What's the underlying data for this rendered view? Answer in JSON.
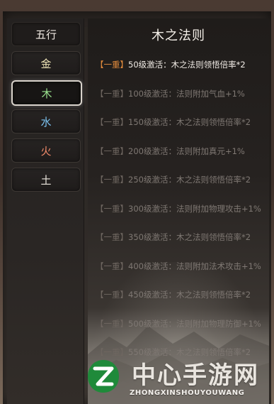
{
  "elements": {
    "header_label": "五行",
    "items": [
      {
        "label": "金",
        "color": "#f0e6b8"
      },
      {
        "label": "木",
        "color": "#9be38f"
      },
      {
        "label": "水",
        "color": "#7cc4f2"
      },
      {
        "label": "火",
        "color": "#f08a6a"
      },
      {
        "label": "土",
        "color": "#e9e4dc"
      }
    ]
  },
  "law_panel": {
    "title": "木之法则",
    "rows": [
      {
        "tier": "【一重】",
        "text": "50级激活：木之法则领悟倍率*2",
        "active": true
      },
      {
        "tier": "【一重】",
        "text": "100级激活：法则附加气血+1%",
        "active": false
      },
      {
        "tier": "【一重】",
        "text": "150级激活：木之法则领悟倍率*2",
        "active": false
      },
      {
        "tier": "【一重】",
        "text": "200级激活：法则附加真元+1%",
        "active": false
      },
      {
        "tier": "【一重】",
        "text": "250级激活：木之法则领悟倍率*2",
        "active": false
      },
      {
        "tier": "【一重】",
        "text": "300级激活：法则附加物理攻击+1%",
        "active": false
      },
      {
        "tier": "【一重】",
        "text": "350级激活：木之法则领悟倍率*2",
        "active": false
      },
      {
        "tier": "【一重】",
        "text": "400级激活：法则附加法术攻击+1%",
        "active": false
      },
      {
        "tier": "【一重】",
        "text": "450级激活：木之法则领悟倍率*2",
        "active": false
      },
      {
        "tier": "【一重】",
        "text": "500级激活：法则附加物理防御+1%",
        "active": false
      },
      {
        "tier": "【一重】",
        "text": "550级激活：木之法则领悟倍率*2",
        "active": false
      }
    ]
  },
  "selected_element": "木",
  "watermark": {
    "name_cn": "中心手游网",
    "name_en": "ZHONGXINSHOUYOUWANG"
  }
}
